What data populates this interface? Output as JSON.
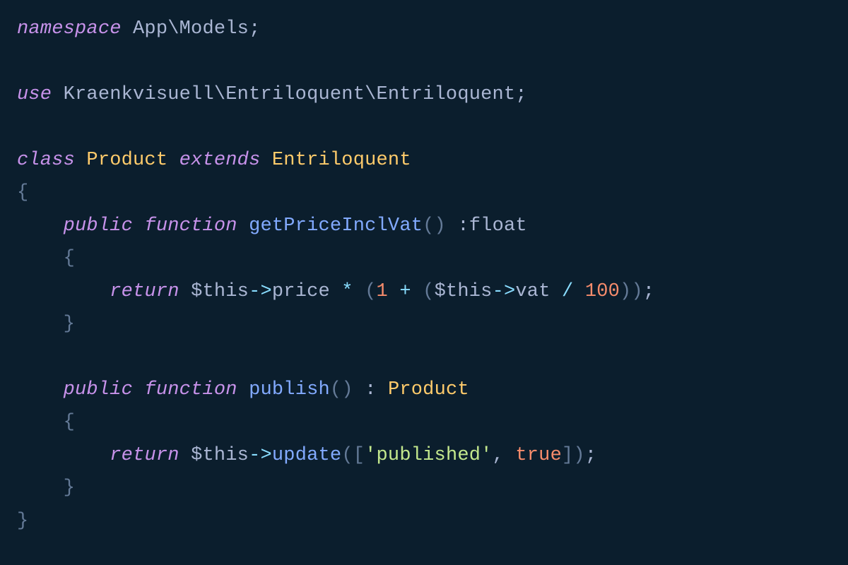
{
  "colors": {
    "background": "#0b1e2d",
    "keyword": "#c792ea",
    "default": "#aab6d3",
    "class": "#ffcb6b",
    "function": "#82aaff",
    "operator": "#89ddff",
    "number": "#f78c6c",
    "string": "#c3e88d",
    "brace": "#647a97"
  },
  "code": {
    "line1": {
      "kw_namespace": "namespace",
      "ns_path": "App\\Models",
      "semi": ";"
    },
    "line3": {
      "kw_use": "use",
      "use_path": "Kraenkvisuell\\Entriloquent\\Entriloquent",
      "semi": ";"
    },
    "line5": {
      "kw_class": "class",
      "class_name": "Product",
      "kw_extends": "extends",
      "base_class": "Entriloquent"
    },
    "line6": {
      "brace": "{"
    },
    "line7": {
      "kw_public": "public",
      "kw_function": "function",
      "fn_name": "getPriceInclVat",
      "parens": "()",
      "type": " :float"
    },
    "line8": {
      "brace": "{"
    },
    "line9": {
      "kw_return": "return",
      "var1": "$this",
      "arrow1": "->",
      "prop1": "price",
      "star": " * ",
      "lp1": "(",
      "num1": "1",
      "plus": " + ",
      "lp2": "(",
      "var2": "$this",
      "arrow2": "->",
      "prop2": "vat",
      "div": " / ",
      "num2": "100",
      "rp2": ")",
      "rp1": ")",
      "semi": ";"
    },
    "line10": {
      "brace": "}"
    },
    "line12": {
      "kw_public": "public",
      "kw_function": "function",
      "fn_name": "publish",
      "parens": "()",
      "colon": " : ",
      "ret_type": "Product"
    },
    "line13": {
      "brace": "{"
    },
    "line14": {
      "kw_return": "return",
      "var": "$this",
      "arrow": "->",
      "fn": "update",
      "lp": "(",
      "lb": "[",
      "str": "'published'",
      "comma": ", ",
      "bool": "true",
      "rb": "]",
      "rp": ")",
      "semi": ";"
    },
    "line15": {
      "brace": "}"
    },
    "line16": {
      "brace": "}"
    }
  }
}
